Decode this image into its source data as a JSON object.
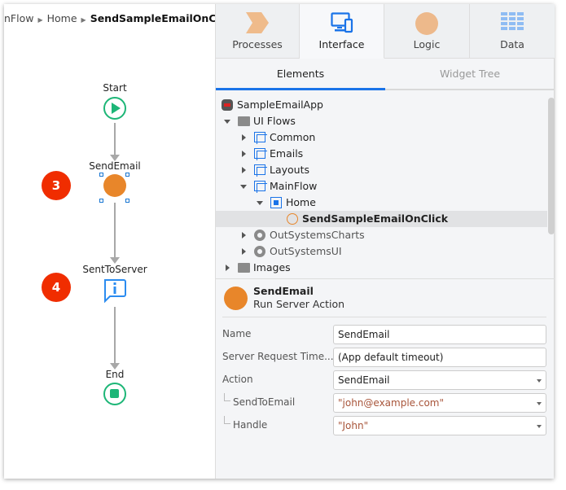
{
  "breadcrumb": {
    "items": [
      "nFlow",
      "Home",
      "SendSampleEmailOnClick"
    ]
  },
  "flow": {
    "nodes": [
      {
        "label": "Start",
        "icon": "start-icon"
      },
      {
        "label": "SendEmail",
        "icon": "server-action-icon",
        "badge": "3"
      },
      {
        "label": "SentToServer",
        "icon": "message-icon",
        "badge": "4"
      },
      {
        "label": "End",
        "icon": "end-icon"
      }
    ]
  },
  "tabs": [
    {
      "label": "Processes",
      "icon": "processes-icon"
    },
    {
      "label": "Interface",
      "icon": "interface-icon",
      "active": true
    },
    {
      "label": "Logic",
      "icon": "logic-icon"
    },
    {
      "label": "Data",
      "icon": "data-icon"
    }
  ],
  "subtabs": [
    {
      "label": "Elements",
      "active": true
    },
    {
      "label": "Widget Tree"
    }
  ],
  "tree": [
    {
      "label": "SampleEmailApp"
    },
    {
      "label": "UI Flows"
    },
    {
      "label": "Common"
    },
    {
      "label": "Emails"
    },
    {
      "label": "Layouts"
    },
    {
      "label": "MainFlow"
    },
    {
      "label": "Home"
    },
    {
      "label": "SendSampleEmailOnClick",
      "selected": true
    },
    {
      "label": "OutSystemsCharts"
    },
    {
      "label": "OutSystemsUI"
    },
    {
      "label": "Images"
    }
  ],
  "properties": {
    "title": "SendEmail",
    "subtitle": "Run Server Action",
    "fields": [
      {
        "label": "Name",
        "value": "SendEmail"
      },
      {
        "label": "Server Request Time...",
        "value": "(App default timeout)"
      },
      {
        "label": "Action",
        "value": "SendEmail"
      },
      {
        "label": "SendToEmail",
        "value": "\"john@example.com\""
      },
      {
        "label": "Handle",
        "value": "\"John\""
      }
    ]
  },
  "colors": {
    "accent": "#1a73e8",
    "orange": "#e8862a",
    "green": "#1db677",
    "badge": "#f02d00"
  }
}
